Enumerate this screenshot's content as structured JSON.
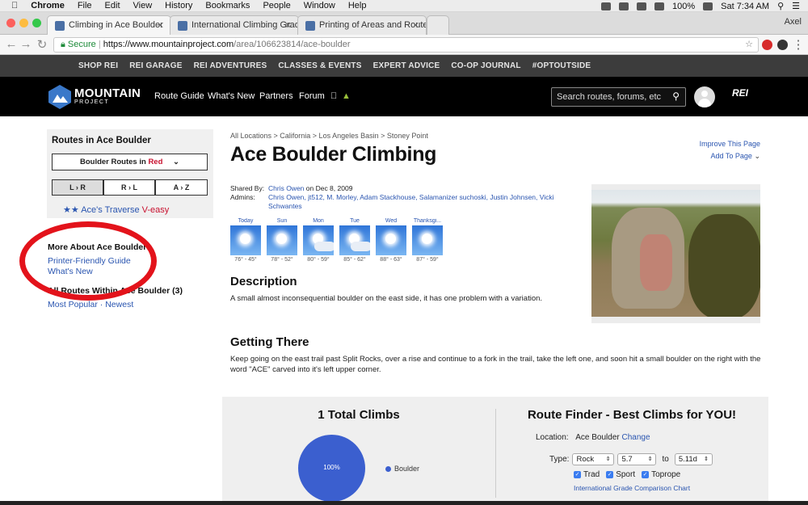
{
  "menubar": {
    "apple": "",
    "app": "Chrome",
    "items": [
      "File",
      "Edit",
      "View",
      "History",
      "Bookmarks",
      "People",
      "Window",
      "Help"
    ],
    "battery": "100%",
    "time": "Sat 7:34 AM"
  },
  "tabs": [
    {
      "title": "Climbing in Ace Boulder"
    },
    {
      "title": "International Climbing Grade C"
    },
    {
      "title": "Printing of Areas and Routes a"
    }
  ],
  "browser_user": "Axel",
  "address": {
    "secure": "Secure",
    "host": "https://www.mountainproject.com",
    "path": "/area/106623814/ace-boulder"
  },
  "rei_nav": [
    "SHOP REI",
    "REI GARAGE",
    "REI ADVENTURES",
    "CLASSES & EVENTS",
    "EXPERT ADVICE",
    "CO-OP JOURNAL",
    "#OPTOUTSIDE"
  ],
  "site": {
    "logo": "MOUNTAIN",
    "logo_sub": "PROJECT",
    "nav": [
      "Route Guide",
      "What's New",
      "Partners",
      "Forum"
    ],
    "search_placeholder": "Search routes, forums, etc",
    "rei_logo": "REI"
  },
  "sidebar": {
    "heading": "Routes in Ace Boulder",
    "select_prefix": "Boulder Routes in ",
    "select_color": "Red",
    "sort": [
      "L › R",
      "R › L",
      "A › Z"
    ],
    "route_stars": "★★",
    "route_name": "Ace's Traverse",
    "route_grade": "V-easy",
    "more_heading": "More About Ace Boulder",
    "printer_link": "Printer-Friendly Guide",
    "whats_new_link": "What's New",
    "all_routes_heading": "All Routes Within Ace Boulder (3)",
    "most_popular": "Most Popular",
    "separator": "·",
    "newest": "Newest"
  },
  "main": {
    "breadcrumb": "All Locations > California > Los Angeles Basin > Stoney Point",
    "title": "Ace Boulder Climbing",
    "improve": "Improve This Page",
    "add_to_page": "Add To Page",
    "shared_label": "Shared By:",
    "shared_by": "Chris Owen",
    "shared_on": " on Dec 8, 2009",
    "admins_label": "Admins:",
    "admins": "Chris Owen, jt512, M. Morley, Adam Stackhouse, Salamanizer suchoski, Justin Johnsen, Vicki Schwantes",
    "weather": [
      {
        "day": "Today",
        "temp": "76° - 45°"
      },
      {
        "day": "Sun",
        "temp": "78° - 52°"
      },
      {
        "day": "Mon",
        "temp": "80° - 59°"
      },
      {
        "day": "Tue",
        "temp": "85° - 62°"
      },
      {
        "day": "Wed",
        "temp": "88° - 63°"
      },
      {
        "day": "Thanksgi...",
        "temp": "87° - 59°"
      }
    ],
    "description_heading": "Description",
    "description": "A small almost inconsequential boulder on the east side, it has one problem with a variation.",
    "getting_there_heading": "Getting There",
    "getting_there": "Keep going on the east trail past Split Rocks, over a rise and continue to a fork in the trail, take the left one, and soon hit a small boulder on the right with the word \"ACE\" carved into it's left upper corner."
  },
  "stats": {
    "total_heading": "1 Total Climbs",
    "pie_label": "100%",
    "legend": "Boulder",
    "finder_heading": "Route Finder - Best Climbs for YOU!",
    "location_label": "Location:",
    "location_value": "Ace Boulder",
    "change": "Change",
    "type_label": "Type:",
    "type_value": "Rock",
    "grade_from": "5.7",
    "to": "to",
    "grade_to": "5.11d",
    "checks": [
      "Trad",
      "Sport",
      "Toprope"
    ],
    "compare_link": "International Grade Comparison Chart"
  },
  "colors": {
    "accent_link": "#2a55b0",
    "red_highlight": "#e3131b",
    "pie": "#3b5fcf"
  }
}
